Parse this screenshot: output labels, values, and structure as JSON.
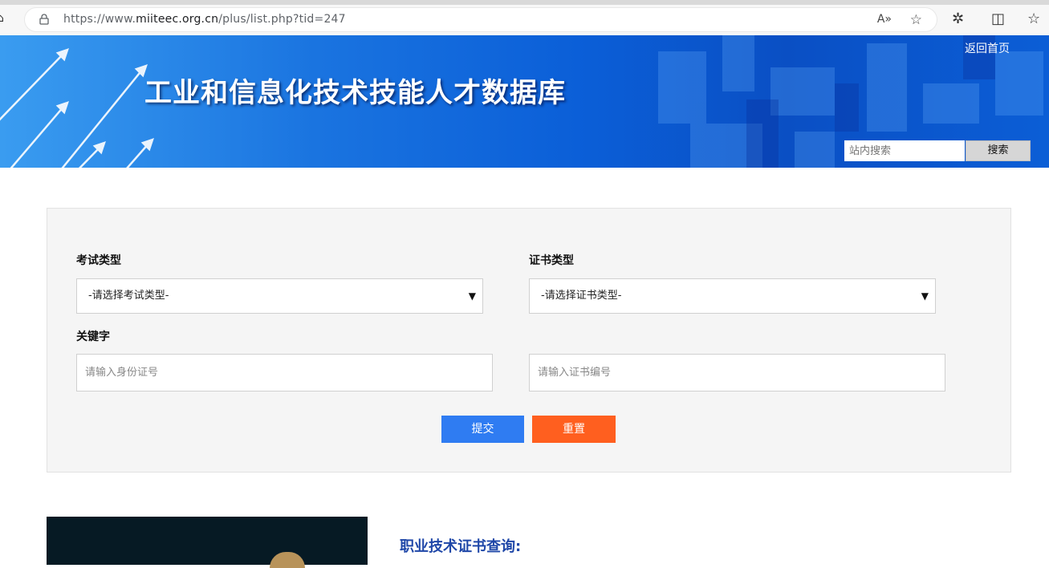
{
  "browser": {
    "url_prefix": "https://www.",
    "url_host": "miiteec.org.cn",
    "url_path": "/plus/list.php?tid=247",
    "read_aloud": "A»"
  },
  "banner": {
    "title": "工业和信息化技术技能人才数据库",
    "home_link": "返回首页",
    "search_placeholder": "站内搜索",
    "search_button": "搜索"
  },
  "form": {
    "exam_type_label": "考试类型",
    "exam_type_selected": "-请选择考试类型-",
    "cert_type_label": "证书类型",
    "cert_type_selected": "-请选择证书类型-",
    "keyword_label": "关键字",
    "id_placeholder": "请输入身份证号",
    "cert_no_placeholder": "请输入证书编号",
    "submit_label": "提交",
    "reset_label": "重置"
  },
  "section": {
    "title": "职业技术证书查询:"
  },
  "colors": {
    "submit": "#2f7cf2",
    "reset": "#ff5f1f",
    "section_title": "#1f47a8"
  }
}
